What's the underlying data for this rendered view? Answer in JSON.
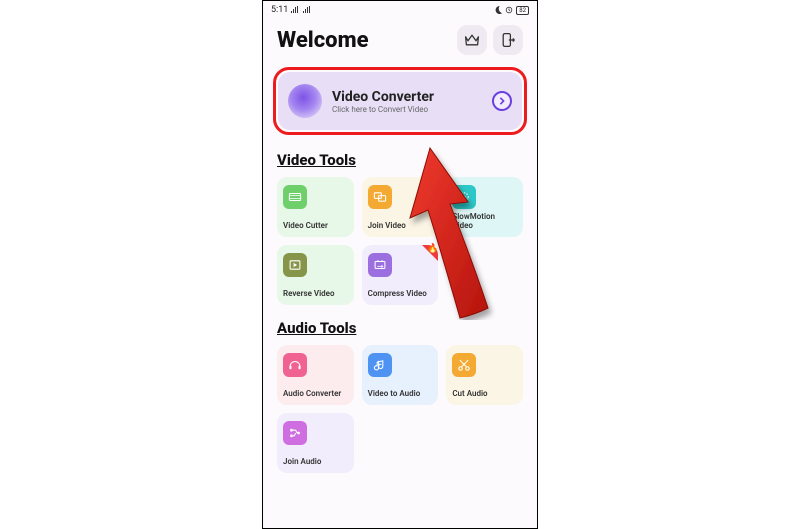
{
  "status": {
    "time": "5:11"
  },
  "header": {
    "title": "Welcome"
  },
  "main_card": {
    "title": "Video Converter",
    "subtitle": "Click here to Convert Video"
  },
  "sections": {
    "video": {
      "label": "Video Tools",
      "tools": [
        {
          "label": "Video Cutter"
        },
        {
          "label": "Join Video"
        },
        {
          "label": "SlowMotion Video"
        },
        {
          "label": "Reverse Video"
        },
        {
          "label": "Compress Video"
        }
      ]
    },
    "audio": {
      "label": "Audio Tools",
      "tools": [
        {
          "label": "Audio Converter"
        },
        {
          "label": "Video to Audio"
        },
        {
          "label": "Cut Audio"
        },
        {
          "label": "Join Audio"
        }
      ]
    }
  }
}
